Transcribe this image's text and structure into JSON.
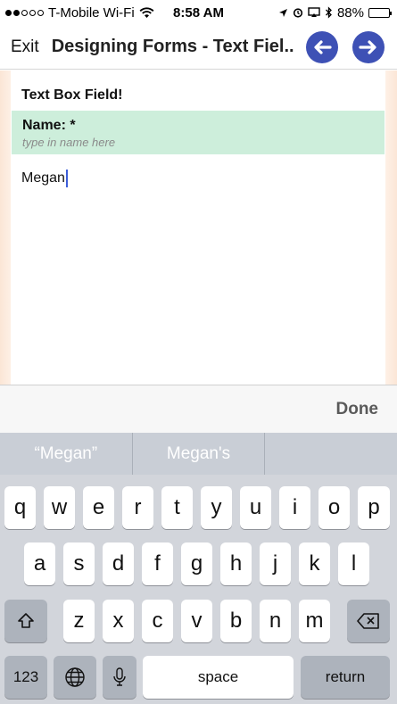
{
  "status": {
    "carrier": "T-Mobile Wi-Fi",
    "time": "8:58 AM",
    "battery": "88%",
    "signal_dots_filled": 2,
    "signal_dots_total": 5
  },
  "nav": {
    "exit_label": "Exit",
    "title": "Designing Forms - Text Fiel...",
    "prev_icon": "arrow-left-icon",
    "next_icon": "arrow-right-icon"
  },
  "form": {
    "section_title": "Text Box Field!",
    "field_label": "Name: *",
    "field_hint": "type in name here",
    "field_value": "Megan"
  },
  "keyboard_accessory": {
    "done_label": "Done"
  },
  "suggestions": [
    "“Megan”",
    "Megan's",
    ""
  ],
  "keyboard": {
    "row1": [
      "q",
      "w",
      "e",
      "r",
      "t",
      "y",
      "u",
      "i",
      "o",
      "p"
    ],
    "row2": [
      "a",
      "s",
      "d",
      "f",
      "g",
      "h",
      "j",
      "k",
      "l"
    ],
    "row3": [
      "z",
      "x",
      "c",
      "v",
      "b",
      "n",
      "m"
    ],
    "numbers_label": "123",
    "space_label": "space",
    "return_label": "return"
  },
  "colors": {
    "accent": "#3e51b5",
    "label_bg": "#cdeedb",
    "caret": "#3d5ed9"
  }
}
